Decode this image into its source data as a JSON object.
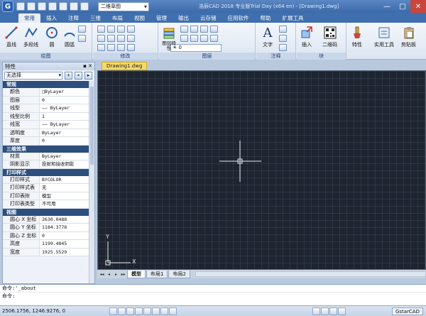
{
  "titlebar": {
    "logo": "G",
    "workspace": "二维草图",
    "title": "浩辰CAD 2018 专业版Trial Day (x64 en) - [Drawing1.dwg]",
    "buttons": {
      "minimize": "—",
      "maximize": "□",
      "close": "✕"
    }
  },
  "tabs": [
    "常用",
    "插入",
    "注释",
    "三维",
    "布局",
    "视图",
    "管理",
    "输出",
    "云存储",
    "应用软件",
    "帮助",
    "扩展工具"
  ],
  "ribbon": {
    "draw": {
      "caption": "绘图",
      "tools": [
        "直线",
        "多段线",
        "圆",
        "圆弧"
      ]
    },
    "modify": {
      "caption": "修改"
    },
    "layer": {
      "caption": "图层",
      "props_label": "图层特性",
      "current": "0"
    },
    "annotate": {
      "caption": "注释",
      "text_label": "文字"
    },
    "block": {
      "caption": "块",
      "insert_label": "插入",
      "qr_label": "二维码"
    },
    "extra": {
      "props_label": "特性",
      "util_label": "实用工具",
      "clip_label": "剪贴板"
    }
  },
  "properties": {
    "title": "特性",
    "title_controls": "▪ ✕",
    "selection": "无选择",
    "sections": [
      {
        "name": "常规",
        "rows": [
          {
            "k": "颜色",
            "v": "□ByLayer"
          },
          {
            "k": "图层",
            "v": "0"
          },
          {
            "k": "线型",
            "v": "—— ByLayer"
          },
          {
            "k": "线型比例",
            "v": "1"
          },
          {
            "k": "线宽",
            "v": "—— ByLayer"
          },
          {
            "k": "透明度",
            "v": "ByLayer"
          },
          {
            "k": "厚度",
            "v": "0"
          }
        ]
      },
      {
        "name": "三维效果",
        "rows": [
          {
            "k": "材质",
            "v": "ByLayer"
          },
          {
            "k": "阴影显示",
            "v": "投射和接收阴影"
          }
        ]
      },
      {
        "name": "打印样式",
        "rows": [
          {
            "k": "打印样式",
            "v": "BYCOLOR"
          },
          {
            "k": "打印样式表",
            "v": "无"
          },
          {
            "k": "打印表附",
            "v": "模型"
          },
          {
            "k": "打印表类型",
            "v": "不可用"
          }
        ]
      },
      {
        "name": "视图",
        "rows": [
          {
            "k": "圆心 X 坐标",
            "v": "2630.0488"
          },
          {
            "k": "圆心 Y 坐标",
            "v": "1184.3778"
          },
          {
            "k": "圆心 Z 坐标",
            "v": "0"
          },
          {
            "k": "高度",
            "v": "1199.4845"
          },
          {
            "k": "宽度",
            "v": "1925.5529"
          }
        ]
      }
    ]
  },
  "document": {
    "tab": "Drawing1.dwg",
    "ucs": {
      "x_label": "X",
      "y_label": "Y"
    },
    "layout_tabs": [
      "模型",
      "布局1",
      "布局2"
    ],
    "nav": [
      "◂◂",
      "◂",
      "▸",
      "▸▸"
    ]
  },
  "command": {
    "history": "命令:'_about",
    "prompt": "命令:"
  },
  "status": {
    "coords": "2506.1756, 1246.9276, 0",
    "brand": "GstarCAD"
  },
  "colors": {
    "accent": "#3f6fae",
    "canvas": "#1e2530",
    "section": "#2d4f7e"
  }
}
